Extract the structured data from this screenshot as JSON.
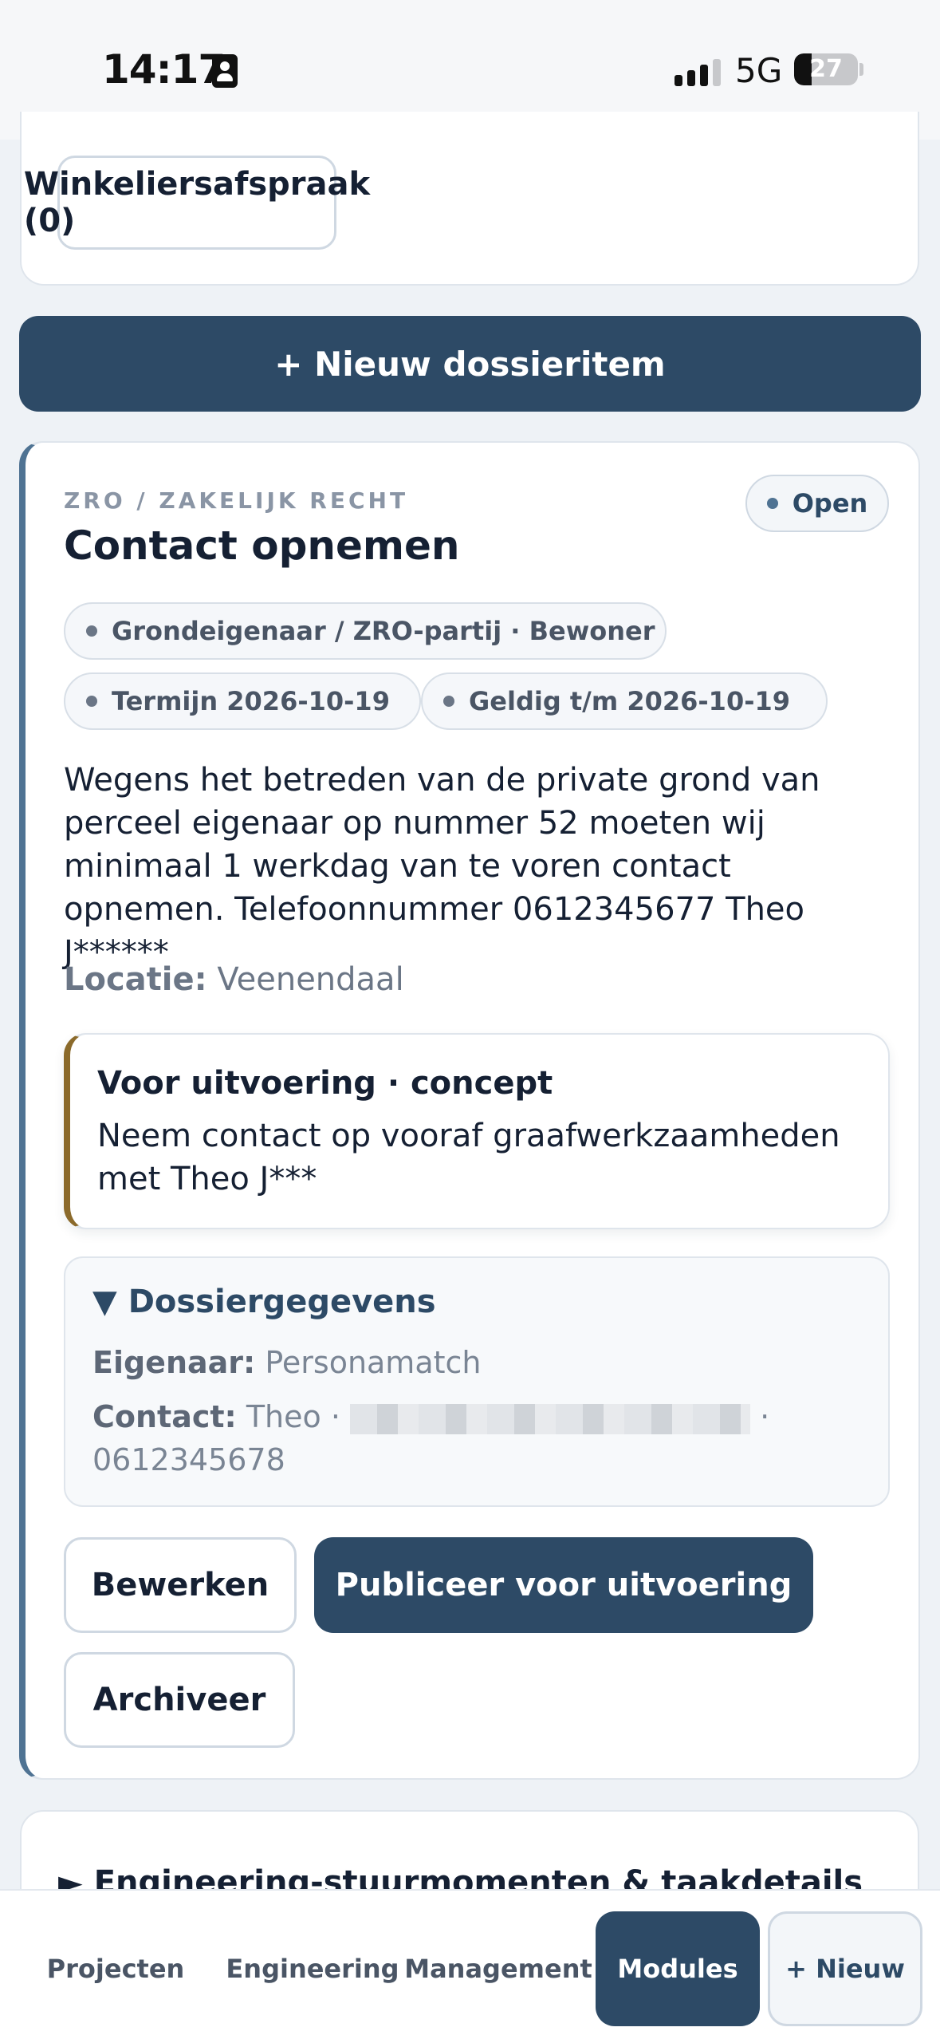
{
  "status_bar": {
    "time": "14:17",
    "network": "5G",
    "battery": "27",
    "battery_level": 0.27
  },
  "filters": {
    "shopkeeper_button": "Winkeliersafspraak (0)"
  },
  "actions": {
    "new_item": "+ Nieuw dossieritem"
  },
  "item": {
    "category": "ZRO / ZAKELIJK RECHT",
    "title": "Contact opnemen",
    "status": "Open",
    "chips": {
      "party": "Grondeigenaar / ZRO-partij · Bewoner",
      "term": "Termijn 2026-10-19",
      "valid": "Geldig t/m 2026-10-19"
    },
    "description": "Wegens het betreden van de private grond van perceel eigenaar op nummer 52 moeten wij minimaal 1 werkdag van te voren contact opnemen. Telefoonnummer 0612345677 Theo J******",
    "location_label": "Locatie:",
    "location_value": "Veenendaal",
    "note": {
      "title": "Voor uitvoering · concept",
      "text": "Neem contact op vooraf graafwerkzaamheden met Theo J***"
    },
    "dossier": {
      "summary": "▼ Dossiergegevens",
      "owner_label": "Eigenaar:",
      "owner_value": "Personamatch",
      "contact_label": "Contact:",
      "contact_name": "Theo ·",
      "contact_separator": "·",
      "contact_phone": "0612345678"
    },
    "buttons": {
      "edit": "Bewerken",
      "publish": "Publiceer voor uitvoering",
      "archive": "Archiveer"
    }
  },
  "collapsed_section": {
    "title": "► Engineering-stuurmomenten & taakdetails"
  },
  "bottom_nav": {
    "projects": "Projecten",
    "engineering": "Engineering",
    "management": "Management",
    "modules": "Modules",
    "new": "+ Nieuw"
  },
  "colors": {
    "primary": "#2d4a66",
    "accent_left": "#4f7393",
    "note_accent": "#8b6a2b"
  }
}
